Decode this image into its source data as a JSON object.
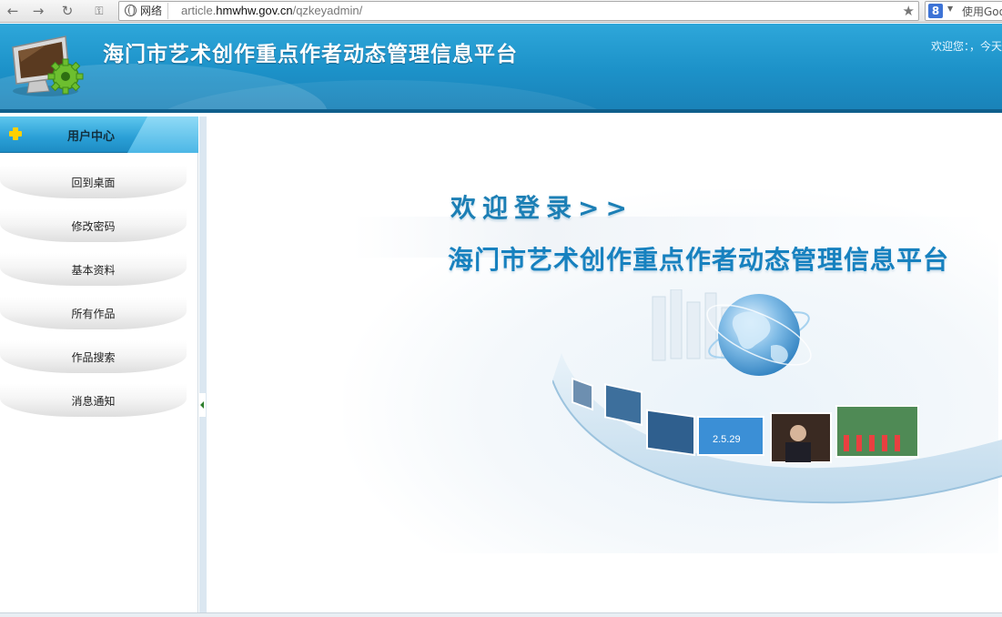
{
  "browser": {
    "address_tag": "网络",
    "url_prefix": "article.",
    "url_domain": "hmwhw.gov.cn",
    "url_path": "/qzkeyadmin/",
    "search_engine_letter": "8",
    "search_placeholder": "使用Goo"
  },
  "header": {
    "title": "海门市艺术创作重点作者动态管理信息平台",
    "welcome_text": "欢迎您：，今天"
  },
  "sidebar": {
    "section_title": "用户中心",
    "items": [
      {
        "label": "回到桌面"
      },
      {
        "label": "修改密码"
      },
      {
        "label": "基本资料"
      },
      {
        "label": "所有作品"
      },
      {
        "label": "作品搜索"
      },
      {
        "label": "消息通知"
      }
    ]
  },
  "main": {
    "welcome_heading": "欢迎登录>>",
    "platform_title": "海门市艺术创作重点作者动态管理信息平台",
    "photo_caption": "2.5.29"
  },
  "colors": {
    "banner": "#1c91c8",
    "accent": "#1781bf",
    "plus_icon": "#ffd000"
  }
}
